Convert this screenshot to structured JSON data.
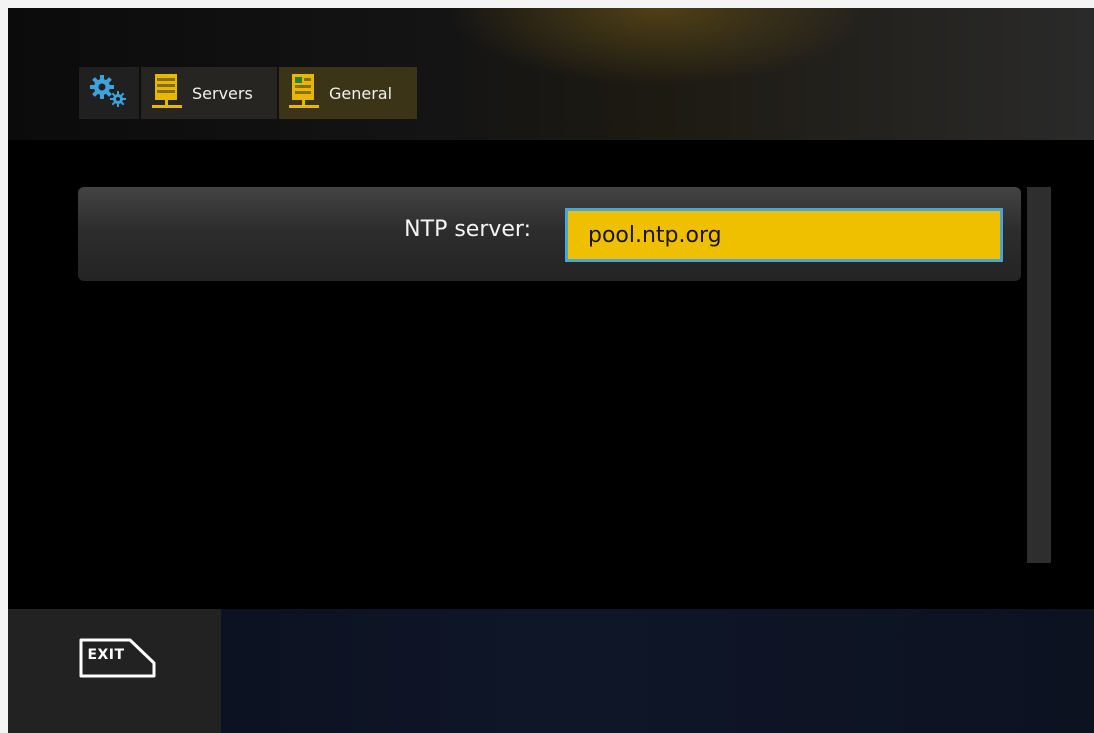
{
  "breadcrumb": {
    "root_icon": "gears-icon",
    "items": [
      {
        "icon": "server-icon",
        "label": "Servers"
      },
      {
        "icon": "network-server-icon",
        "label": "General"
      }
    ]
  },
  "setting": {
    "label": "NTP server:",
    "value": "pool.ntp.org"
  },
  "footer": {
    "exit_label": "EXIT",
    "exit_icon": "exit-key-icon"
  },
  "colors": {
    "accent": "#eec000",
    "focus_border": "#4ba6d8",
    "icon_blue": "#3ea3dc",
    "icon_gold": "#e6b800"
  }
}
